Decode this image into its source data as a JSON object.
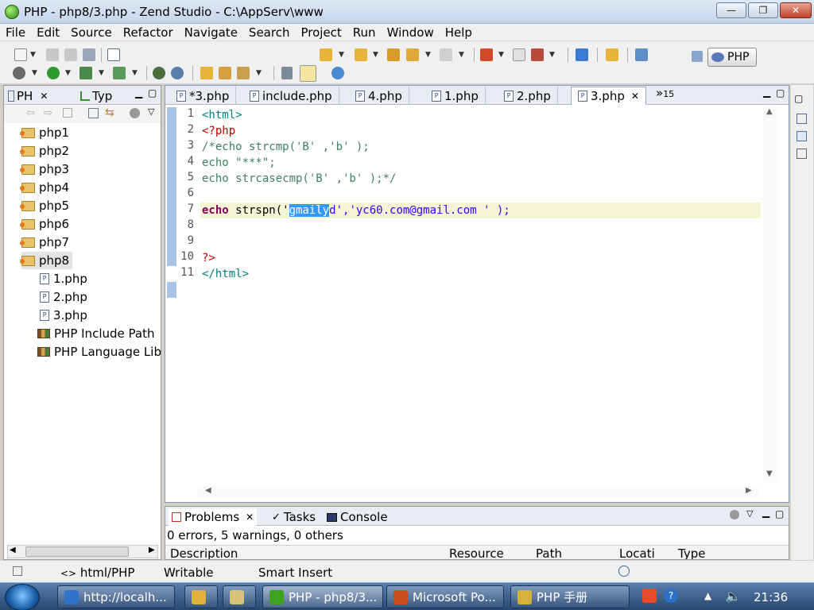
{
  "window": {
    "title": "PHP - php8/3.php - Zend Studio - C:\\AppServ\\www",
    "minimize_glyph": "—",
    "maximize_glyph": "❐",
    "close_glyph": "✕"
  },
  "menu": [
    "File",
    "Edit",
    "Source",
    "Refactor",
    "Navigate",
    "Search",
    "Project",
    "Run",
    "Window",
    "Help"
  ],
  "toolbar": {
    "perspective_label": "PHP"
  },
  "left_panel": {
    "tabs": [
      {
        "label": "PH"
      },
      {
        "label": "Typ"
      }
    ],
    "tree": [
      {
        "label": "php1",
        "kind": "project"
      },
      {
        "label": "php2",
        "kind": "project"
      },
      {
        "label": "php3",
        "kind": "project"
      },
      {
        "label": "php4",
        "kind": "project"
      },
      {
        "label": "php5",
        "kind": "project"
      },
      {
        "label": "php6",
        "kind": "project"
      },
      {
        "label": "php7",
        "kind": "project"
      },
      {
        "label": "php8",
        "kind": "project",
        "selected": true
      },
      {
        "label": "1.php",
        "kind": "file"
      },
      {
        "label": "2.php",
        "kind": "file"
      },
      {
        "label": "3.php",
        "kind": "file"
      },
      {
        "label": "PHP Include Path",
        "kind": "library"
      },
      {
        "label": "PHP Language Lib",
        "kind": "library"
      }
    ]
  },
  "editor": {
    "tabs": [
      {
        "label": "*3.php"
      },
      {
        "label": "include.php"
      },
      {
        "label": "4.php"
      },
      {
        "label": "1.php"
      },
      {
        "label": "2.php"
      },
      {
        "label": "3.php",
        "active": true
      }
    ],
    "overflow_label": "»",
    "overflow_count": "15",
    "lines": [
      {
        "n": "1",
        "text": "<html>"
      },
      {
        "n": "2",
        "text": "<?php"
      },
      {
        "n": "3",
        "text": "/*echo strcmp('B' ,'b' );"
      },
      {
        "n": "4",
        "text": "echo \"***\";"
      },
      {
        "n": "5",
        "text": "echo strcasecmp('B' ,'b' );*/"
      },
      {
        "n": "6",
        "text": ""
      },
      {
        "n": "7",
        "text": "echo strspn('gmailyd','yc60.com@gmail.com ' );"
      },
      {
        "n": "8",
        "text": ""
      },
      {
        "n": "9",
        "text": ""
      },
      {
        "n": "10",
        "text": "?>"
      },
      {
        "n": "11",
        "text": "</html>"
      }
    ],
    "line7_parts": {
      "kw": "echo",
      "pre": " strspn('",
      "sel": "gmaily",
      "post": "d','yc60.com@gmail.com ' );"
    }
  },
  "bottom_panel": {
    "tabs": [
      {
        "label": "Problems"
      },
      {
        "label": "Tasks"
      },
      {
        "label": "Console"
      }
    ],
    "summary": "0 errors, 5 warnings, 0 others",
    "columns": [
      "Description",
      "Resource",
      "Path",
      "Locati",
      "Type"
    ]
  },
  "statusbar": {
    "content_type": "html/PHP",
    "writable": "Writable",
    "insert_mode": "Smart Insert"
  },
  "taskbar": {
    "items": [
      {
        "label": "http://localh...",
        "color": "#2f74c9"
      },
      {
        "label": "",
        "color": "#e0b23a"
      },
      {
        "label": "",
        "color": "#d9c27a"
      },
      {
        "label": "PHP - php8/3...",
        "color": "#3ea320",
        "active": true
      },
      {
        "label": "Microsoft Po...",
        "color": "#c8501e"
      },
      {
        "label": "PHP 手册",
        "color": "#d6b23a"
      }
    ],
    "clock": "21:36"
  }
}
